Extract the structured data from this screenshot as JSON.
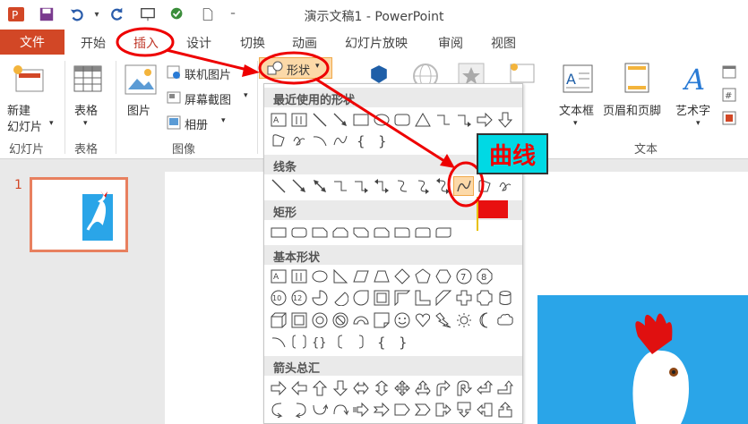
{
  "window": {
    "title": "演示文稿1 - PowerPoint"
  },
  "tabs": {
    "file": "文件",
    "items": [
      "开始",
      "插入",
      "设计",
      "切换",
      "动画",
      "幻灯片放映",
      "审阅",
      "视图"
    ]
  },
  "ribbon": {
    "new_slide": "新建\n幻灯片",
    "new_slide_line1": "新建",
    "new_slide_line2": "幻灯片",
    "table": "表格",
    "picture": "图片",
    "online_picture": "联机图片",
    "screenshot": "屏幕截图",
    "album": "相册",
    "shapes": "形状",
    "textbox": "文本框",
    "header_footer": "页眉和页脚",
    "wordart": "艺术字",
    "groups": {
      "slides": "幻灯片",
      "tables": "表格",
      "images": "图像",
      "text": "文本"
    }
  },
  "dropdown": {
    "recent": "最近使用的形状",
    "lines": "线条",
    "rectangles": "矩形",
    "basic": "基本形状",
    "arrows": "箭头总汇"
  },
  "slides_pane": {
    "number": "1"
  },
  "annotation": {
    "label": "曲线"
  },
  "colors": {
    "accent": "#d24726",
    "callout_bg": "#00d9e4",
    "callout_text": "#e00000",
    "slide_blue": "#2aa5e8"
  }
}
